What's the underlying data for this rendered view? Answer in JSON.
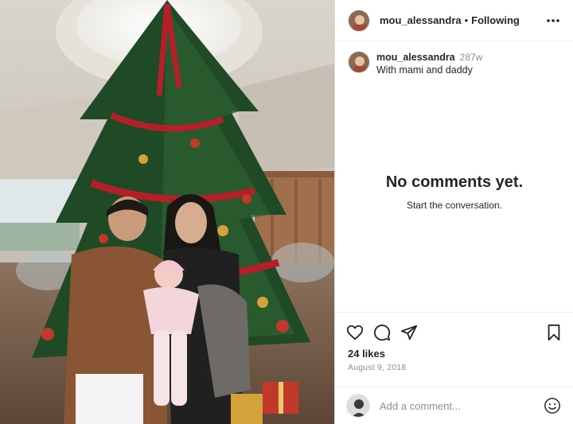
{
  "post": {
    "username": "mou_alessandra",
    "separator": "•",
    "follow_status": "Following",
    "caption": {
      "username": "mou_alessandra",
      "age": "287w",
      "text": "With mami and daddy"
    },
    "photo_icon": "christmas-family-photo"
  },
  "comments": {
    "empty_title": "No comments yet.",
    "empty_subtitle": "Start the conversation."
  },
  "actions": {
    "icons": [
      "heart-icon",
      "comment-icon",
      "share-icon",
      "bookmark-icon"
    ],
    "likes": "24 likes",
    "date": "August 9, 2018"
  },
  "composer": {
    "placeholder": "Add a comment...",
    "emoji_icon": "smiley-icon"
  },
  "colors": {
    "text": "#262626",
    "muted": "#8e8e8e",
    "border": "#dbdbdb"
  }
}
